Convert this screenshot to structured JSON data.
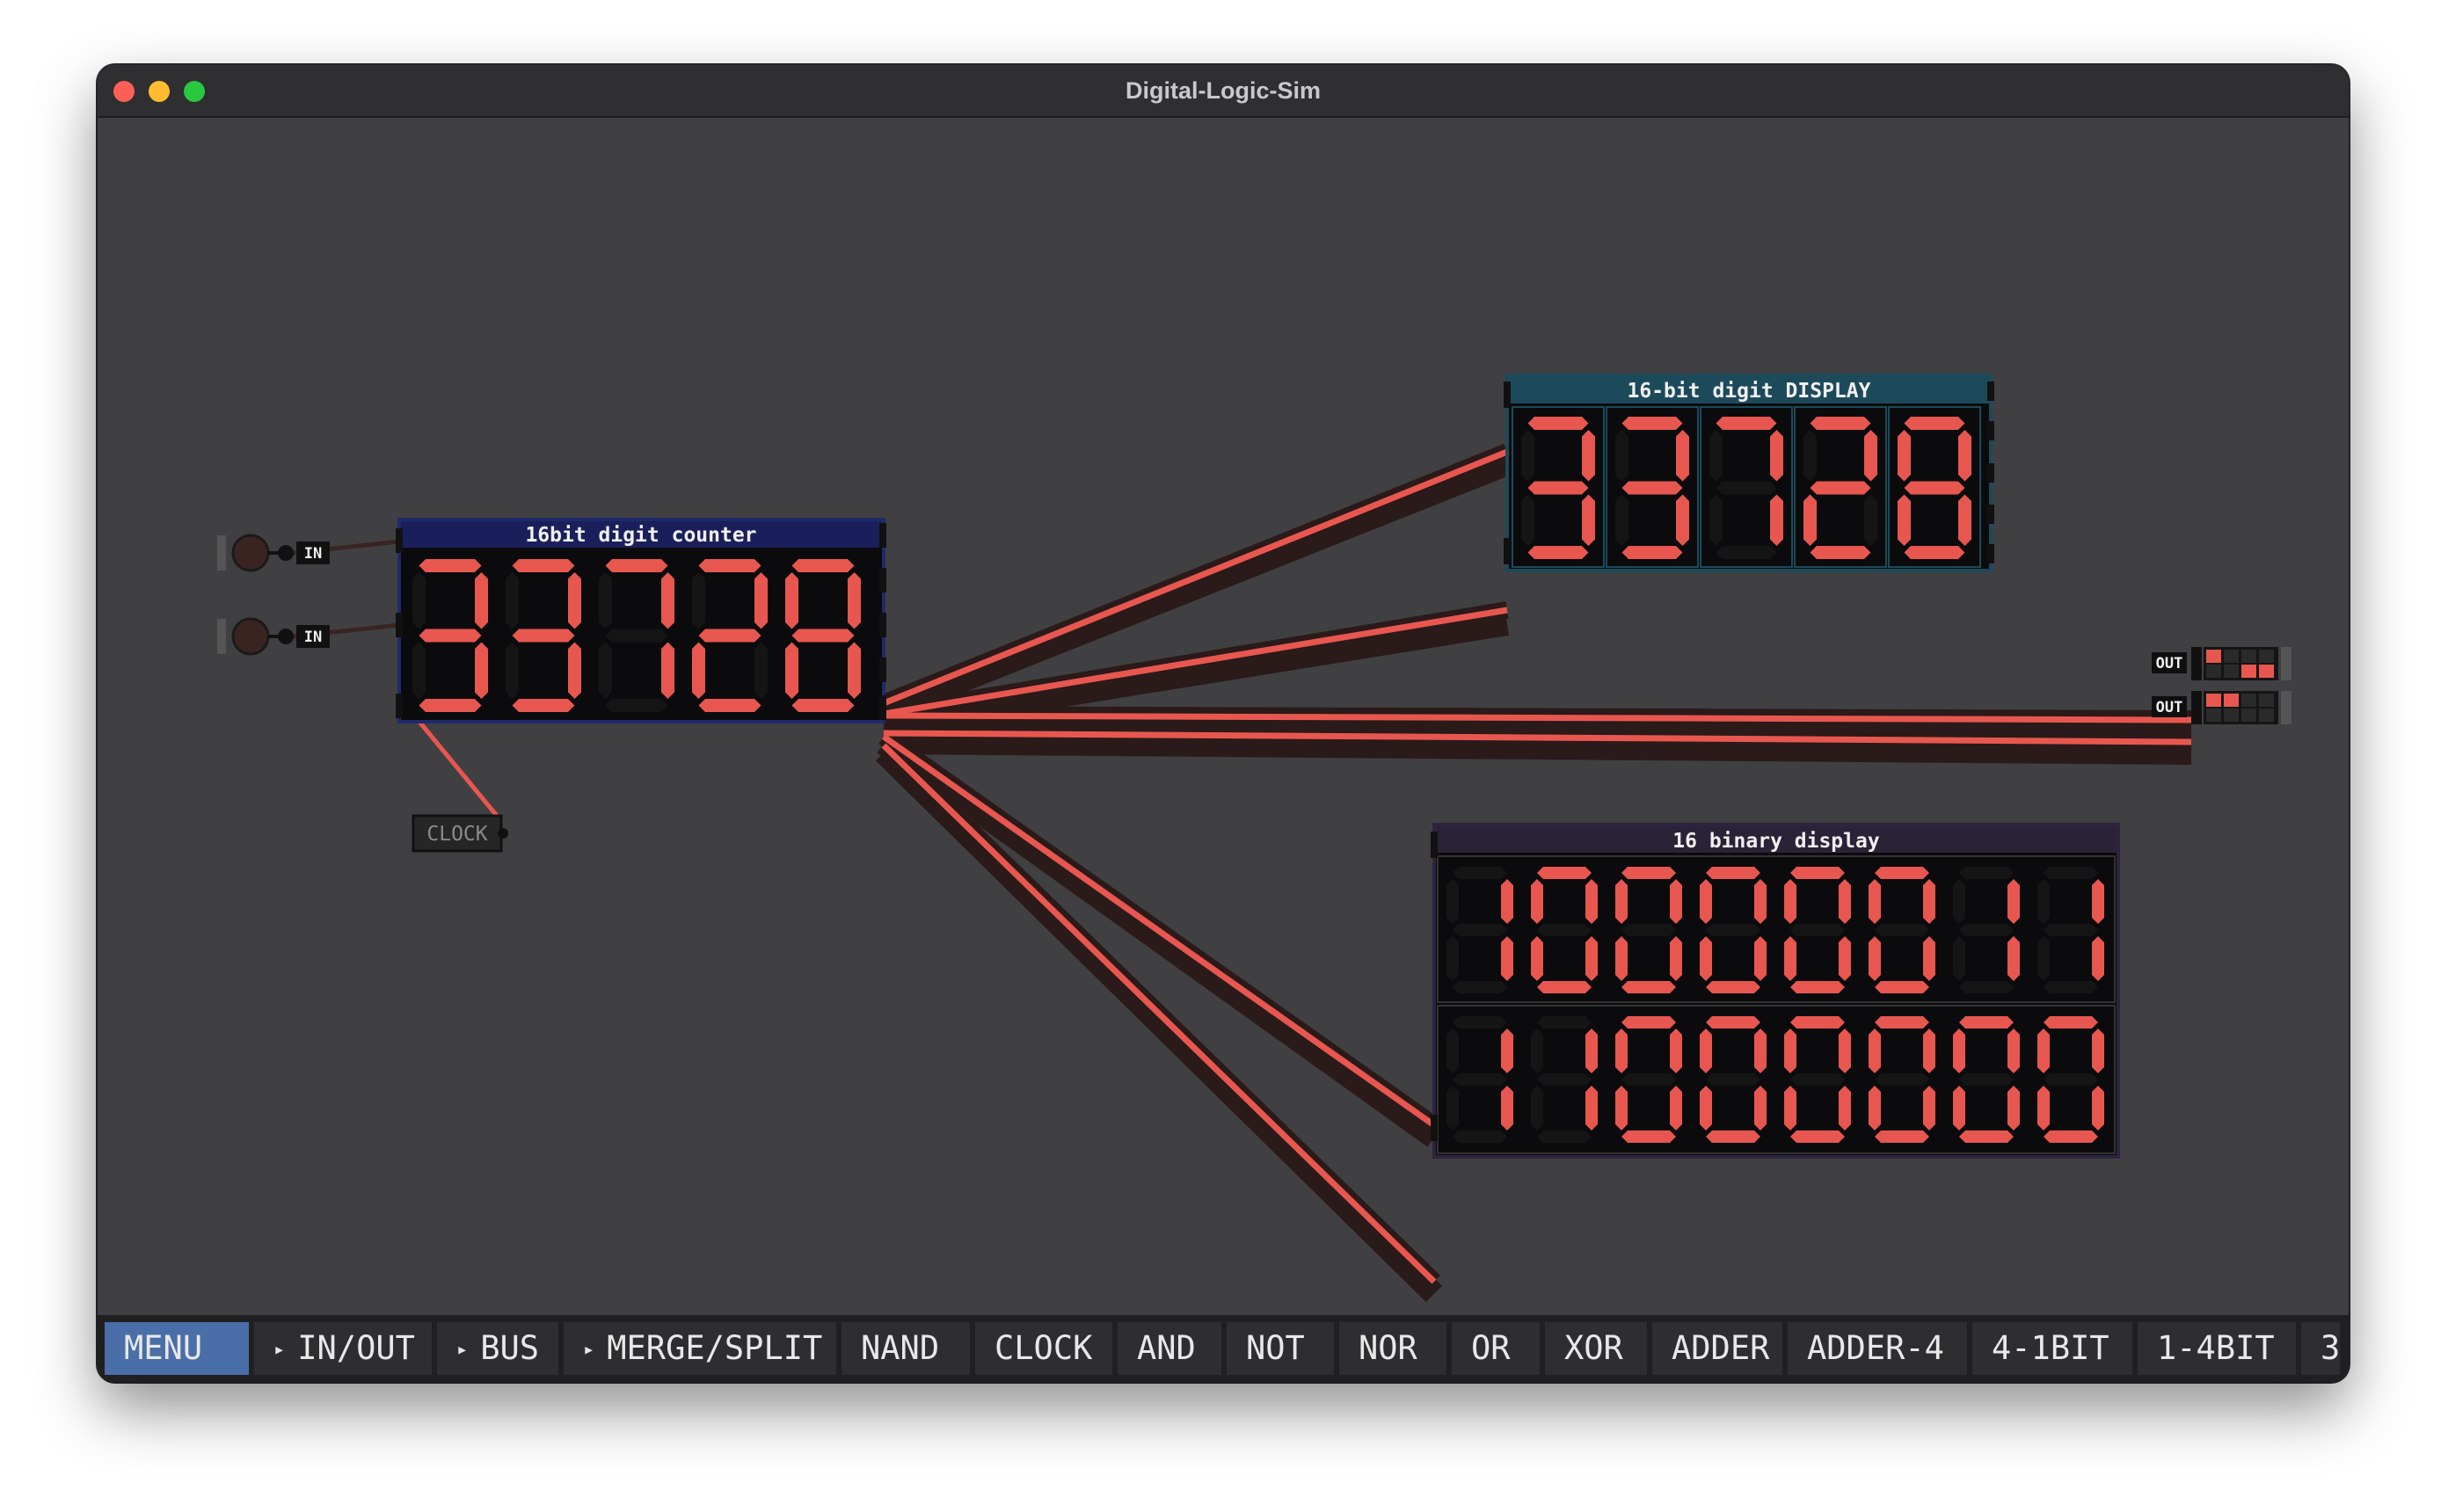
{
  "window": {
    "title": "Digital-Logic-Sim"
  },
  "theme": {
    "wire_on": "#e8574f",
    "segment_on": "#e8574f",
    "segment_off": "#151515",
    "canvas_bg": "#404042"
  },
  "inputs": [
    {
      "label": "IN"
    },
    {
      "label": "IN"
    }
  ],
  "clock": {
    "label": "CLOCK"
  },
  "counter": {
    "title": "16bit digit counter",
    "digits": [
      "3",
      "3",
      "7",
      "2",
      "8"
    ]
  },
  "digit_display": {
    "title": "16-bit digit DISPLAY",
    "digits": [
      "3",
      "3",
      "7",
      "2",
      "8"
    ]
  },
  "outputs": [
    {
      "label": "OUT"
    },
    {
      "label": "OUT"
    }
  ],
  "binary_display": {
    "title": "16 binary display",
    "row1": [
      "1",
      "0",
      "0",
      "0",
      "0",
      "0",
      "1",
      "1"
    ],
    "row2": [
      "1",
      "1",
      "0",
      "0",
      "0",
      "0",
      "0",
      "0"
    ]
  },
  "toolbar": [
    {
      "label": "MENU",
      "arrow": false,
      "active": true
    },
    {
      "label": "IN/OUT",
      "arrow": true
    },
    {
      "label": "BUS",
      "arrow": true
    },
    {
      "label": "MERGE/SPLIT",
      "arrow": true
    },
    {
      "label": "NAND"
    },
    {
      "label": "CLOCK"
    },
    {
      "label": "AND"
    },
    {
      "label": "NOT"
    },
    {
      "label": "NOR"
    },
    {
      "label": "OR"
    },
    {
      "label": "XOR"
    },
    {
      "label": "ADDER"
    },
    {
      "label": "ADDER-4"
    },
    {
      "label": "4-1BIT"
    },
    {
      "label": "1-4BIT"
    },
    {
      "label": "3"
    }
  ]
}
